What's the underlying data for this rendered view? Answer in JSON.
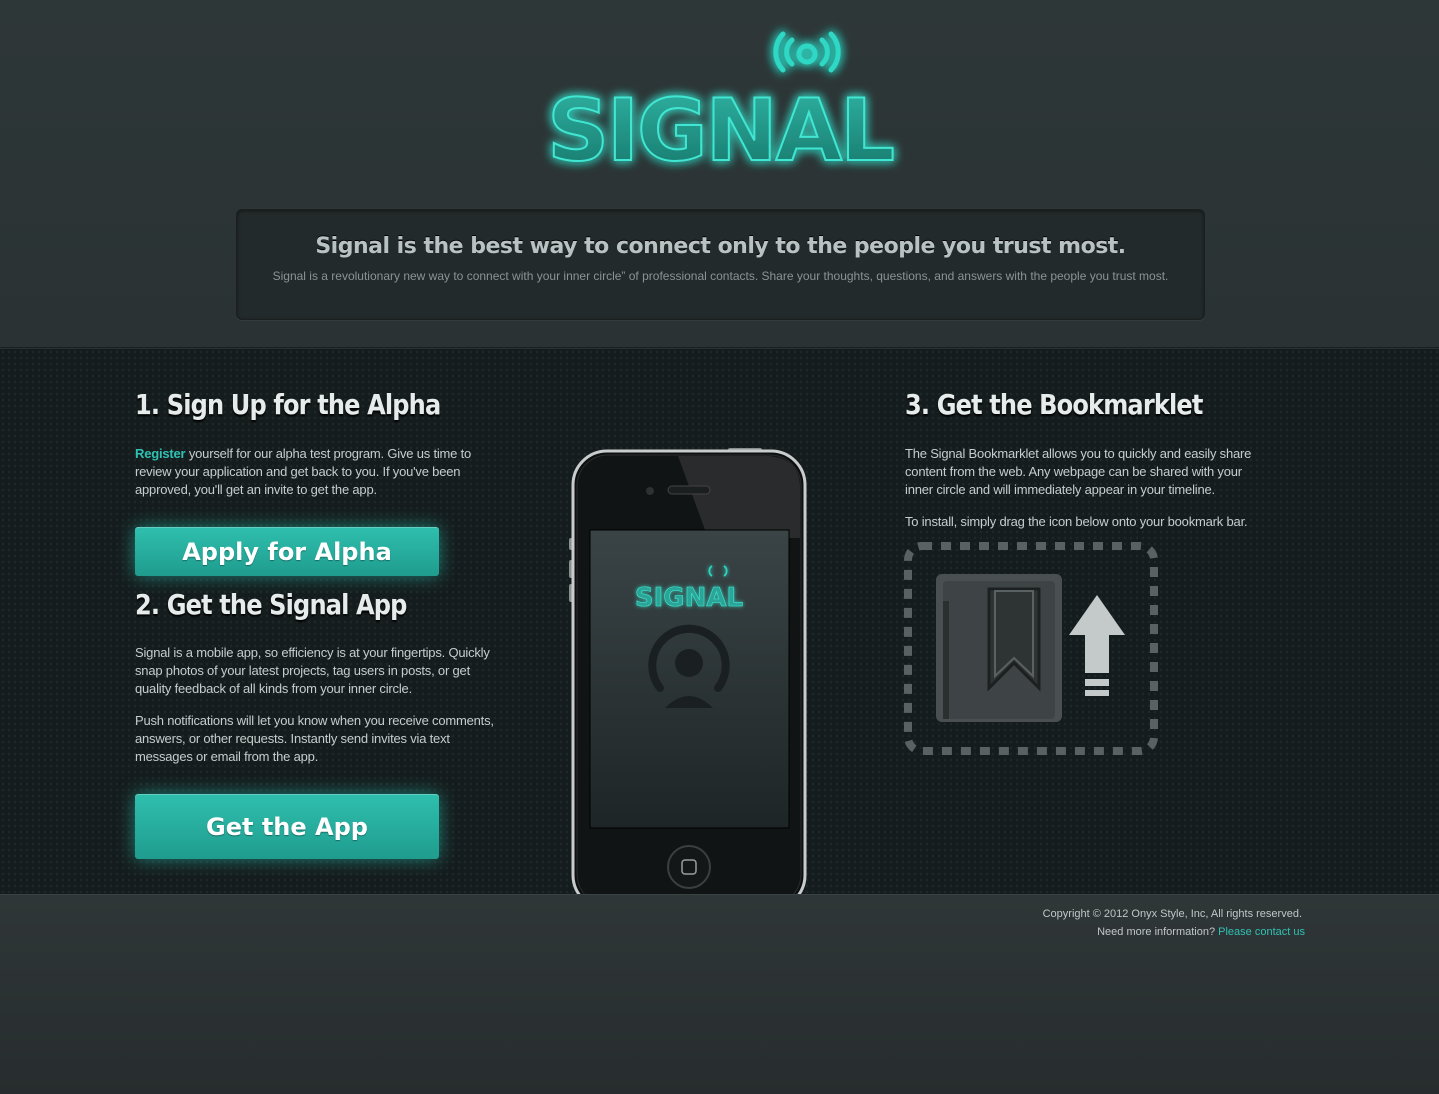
{
  "brand": {
    "logo_text": "SIGNAL",
    "accent": "#2fc1b3"
  },
  "tagline": {
    "title": "Signal is the best way to connect only to the people you trust most.",
    "subtitle": "Signal is a revolutionary new way to connect with your inner circle” of professional contacts. Share your thoughts, questions, and answers with the people you trust most."
  },
  "step1": {
    "title": "1. Sign Up for the Alpha",
    "link": "Register",
    "text": " yourself for our alpha test program. Give us time to review your application and get back to you. If you've been approved, you'll get an invite to get the app.",
    "button": "Apply for Alpha"
  },
  "step2": {
    "title": "2. Get the Signal App",
    "paragraph1": "Signal is a mobile app, so efficiency is at your fingertips. Quickly snap photos of your latest projects, tag users in posts, or get quality feedback of all kinds from your inner circle.",
    "paragraph2": "Push notifications will let you know when you receive comments, answers, or other requests. Instantly send invites via text messages or email from the app.",
    "button": "Get the App"
  },
  "step3": {
    "title": "3. Get the Bookmarklet",
    "paragraph1": "The Signal Bookmarklet allows you to quickly and easily share content from the web. Any webpage can be shared with your inner circle and will immediately appear in your timeline.",
    "paragraph2": "To install, simply drag the icon below onto your bookmark bar.",
    "icon": "bookmark-upload-icon"
  },
  "phone": {
    "app_name": "SIGNAL"
  },
  "footer": {
    "copyright": "Copyright © 2012 Onyx Style, Inc, All rights reserved.",
    "contact_prefix": "Need more information? ",
    "contact_link": "Please contact us"
  }
}
